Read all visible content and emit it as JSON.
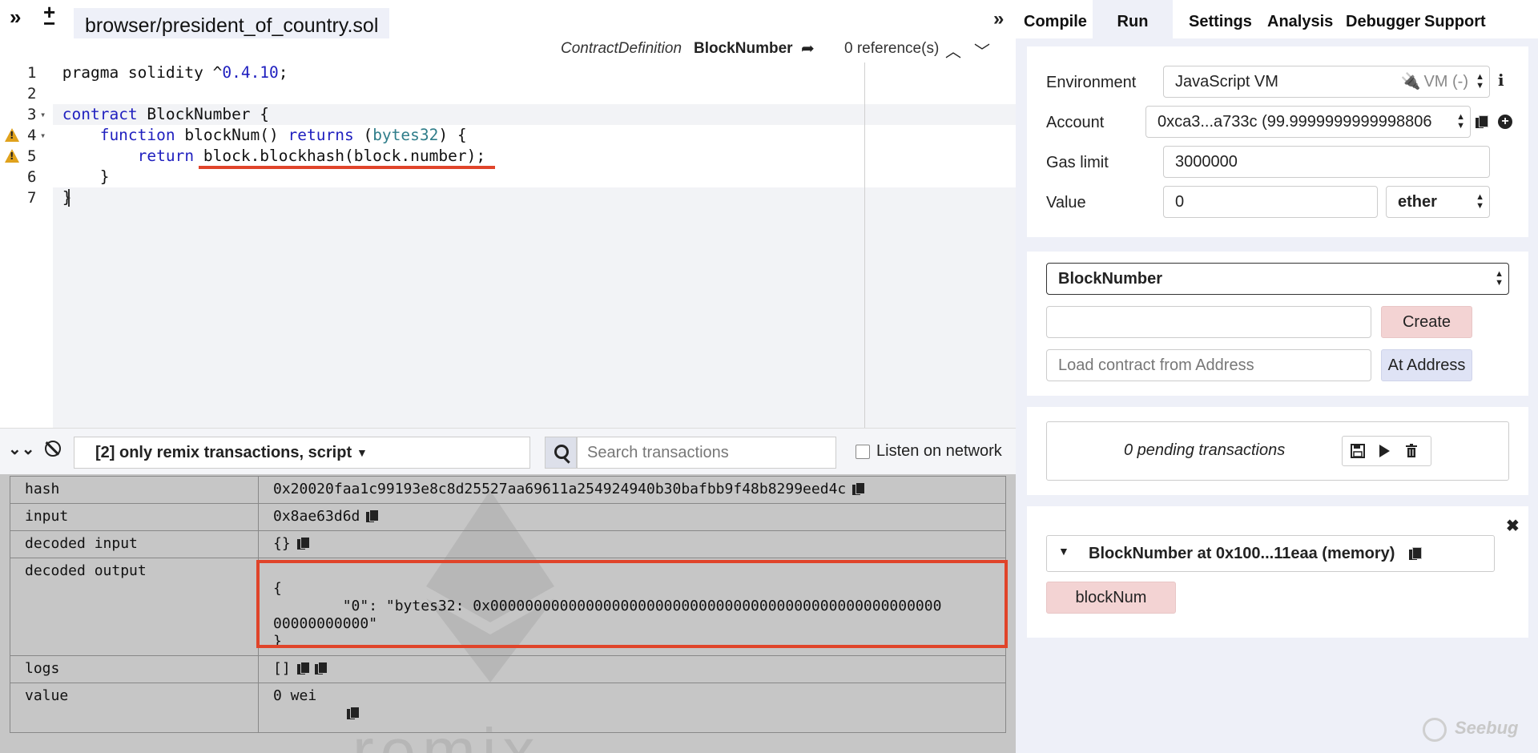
{
  "toolbar": {
    "collapse_glyph": "»",
    "add_glyph": "+",
    "remove_glyph": "−",
    "expand_glyph": "»"
  },
  "editor": {
    "active_tab": "browser/president_of_country.sol",
    "context": {
      "type": "ContractDefinition",
      "name": "BlockNumber",
      "references": "0 reference(s)"
    },
    "line_numbers": [
      "1",
      "2",
      "3",
      "4",
      "5",
      "6",
      "7"
    ],
    "warning_lines": [
      4,
      5
    ],
    "fold_lines": [
      3,
      4
    ]
  },
  "terminal": {
    "filter_label": "[2] only remix transactions, script",
    "search_placeholder": "Search transactions",
    "listen_label": "Listen on network",
    "listen_checked": false,
    "rows": [
      {
        "key": "hash",
        "value": "0x20020faa1c99193e8c8d25527aa69611a254924940b30bafbb9f48b8299eed4c"
      },
      {
        "key": "input",
        "value": "0x8ae63d6d"
      },
      {
        "key": "decoded input",
        "value": "{}"
      },
      {
        "key": "decoded output",
        "line1": "{",
        "line2": "        \"0\": \"bytes32: 0x0000000000000000000000000000000000000000000000000000",
        "line3": "00000000000\"",
        "line4": "}"
      },
      {
        "key": "logs",
        "value": "[]"
      },
      {
        "key": "value",
        "value": "0 wei"
      }
    ],
    "watermark": "remix"
  },
  "right_panel": {
    "tabs": [
      "Compile",
      "Run",
      "Settings",
      "Analysis",
      "Debugger",
      "Support"
    ],
    "active_tab": "Run",
    "environment": {
      "label": "Environment",
      "value": "JavaScript VM",
      "badge": "VM (-)"
    },
    "account": {
      "label": "Account",
      "value": "0xca3...a733c (99.9999999999998806"
    },
    "gas_limit": {
      "label": "Gas limit",
      "value": "3000000"
    },
    "value": {
      "label": "Value",
      "amount": "0",
      "unit": "ether"
    },
    "contract_select": "BlockNumber",
    "create_label": "Create",
    "load_placeholder": "Load contract from Address",
    "at_address_label": "At Address",
    "pending": "0 pending transactions",
    "instance": {
      "title": "BlockNumber at 0x100...11eaa (memory)",
      "function_button": "blockNum"
    }
  },
  "watermark_brand": "Seebug",
  "colors": {
    "error": "#e0442a",
    "warning": "#e0a21c",
    "keyword": "#1f1fbf",
    "type": "#2f7d8a",
    "panel_bg": "#eef0f8",
    "create_bg": "#f3d3d3",
    "at_address_bg": "#dfe3f5"
  }
}
